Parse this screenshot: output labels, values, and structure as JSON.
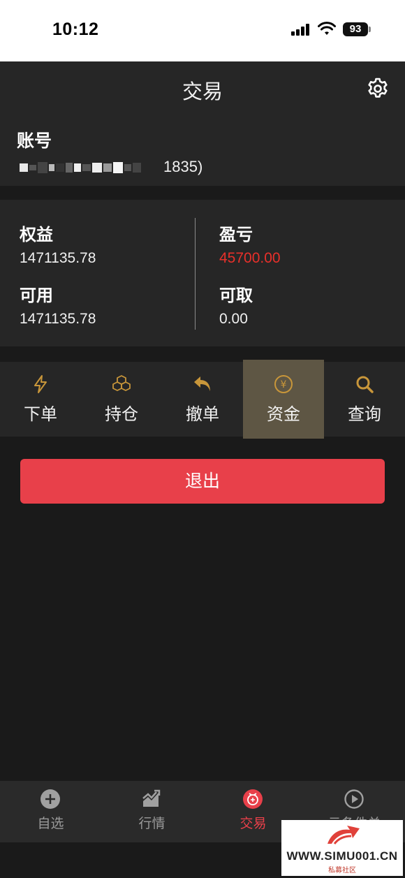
{
  "status_bar": {
    "time": "10:12",
    "battery": "93"
  },
  "nav": {
    "title": "交易"
  },
  "account": {
    "label": "账号",
    "number_visible": "1835)"
  },
  "funds": {
    "equity_label": "权益",
    "equity_value": "1471135.78",
    "available_label": "可用",
    "available_value": "1471135.78",
    "pnl_label": "盈亏",
    "pnl_value": "45700.00",
    "withdrawable_label": "可取",
    "withdrawable_value": "0.00",
    "pnl_color": "#e8302a"
  },
  "actions": [
    {
      "label": "下单",
      "icon": "lightning-icon"
    },
    {
      "label": "持仓",
      "icon": "cubes-icon"
    },
    {
      "label": "撤单",
      "icon": "undo-icon"
    },
    {
      "label": "资金",
      "icon": "yen-icon",
      "active": true
    },
    {
      "label": "查询",
      "icon": "search-icon"
    }
  ],
  "logout": {
    "label": "退出"
  },
  "tabbar": [
    {
      "label": "自选",
      "icon": "plus-circle-icon"
    },
    {
      "label": "行情",
      "icon": "chart-icon"
    },
    {
      "label": "交易",
      "icon": "trade-icon",
      "active": true
    },
    {
      "label": "云条件单",
      "icon": "play-circle-icon"
    }
  ],
  "watermark": {
    "text": "WWW.SIMU001.CN",
    "sub": "私募社区"
  },
  "colors": {
    "accent": "#e8404a",
    "icon_gold": "#c8963a",
    "active_tab_bg": "#5e5644"
  }
}
